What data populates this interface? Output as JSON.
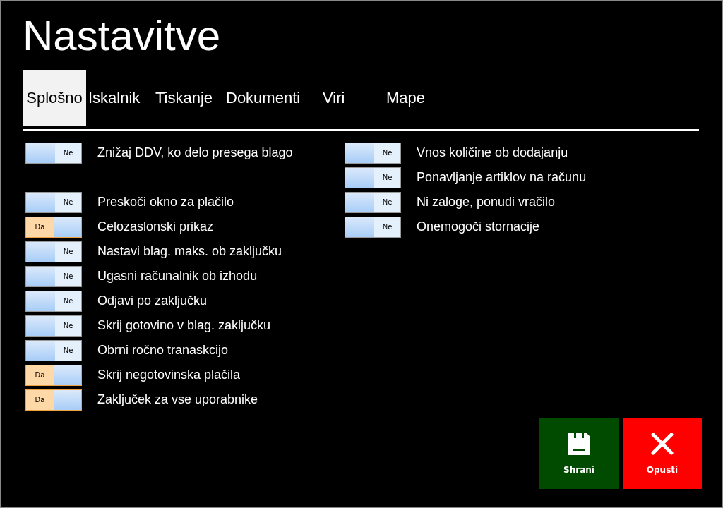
{
  "title": "Nastavitve",
  "tabs": [
    {
      "label": "Splošno",
      "selected": true
    },
    {
      "label": "Iskalnik",
      "selected": false
    },
    {
      "label": "Tiskanje",
      "selected": false
    },
    {
      "label": "Dokumenti",
      "selected": false
    },
    {
      "label": "Viri",
      "selected": false
    },
    {
      "label": "Mape",
      "selected": false
    }
  ],
  "left_groups": [
    {
      "items": [
        {
          "label": "Znižaj DDV, ko delo presega blago",
          "on": false,
          "state_text": "Ne"
        }
      ]
    },
    {
      "items": [
        {
          "label": "Preskoči okno za plačilo",
          "on": false,
          "state_text": "Ne"
        },
        {
          "label": "Celozaslonski prikaz",
          "on": true,
          "state_text": "Da"
        },
        {
          "label": "Nastavi blag. maks. ob zaključku",
          "on": false,
          "state_text": "Ne"
        },
        {
          "label": "Ugasni računalnik ob izhodu",
          "on": false,
          "state_text": "Ne"
        },
        {
          "label": "Odjavi po zaključku",
          "on": false,
          "state_text": "Ne"
        },
        {
          "label": "Skrij gotovino v blag. zaključku",
          "on": false,
          "state_text": "Ne"
        },
        {
          "label": "Obrni ročno tranaskcijo",
          "on": false,
          "state_text": "Ne"
        },
        {
          "label": "Skrij negotovinska plačila",
          "on": true,
          "state_text": "Da"
        },
        {
          "label": "Zaključek za vse uporabnike",
          "on": true,
          "state_text": "Da"
        }
      ]
    }
  ],
  "right_items": [
    {
      "label": "Vnos količine ob dodajanju",
      "on": false,
      "state_text": "Ne"
    },
    {
      "label": "Ponavljanje artiklov na računu",
      "on": false,
      "state_text": "Ne"
    },
    {
      "label": "Ni zaloge, ponudi vračilo",
      "on": false,
      "state_text": "Ne"
    },
    {
      "label": "Onemogoči stornacije",
      "on": false,
      "state_text": "Ne"
    }
  ],
  "buttons": [
    {
      "label": "Shrani",
      "kind": "save"
    },
    {
      "label": "Opusti",
      "kind": "cancel"
    }
  ]
}
